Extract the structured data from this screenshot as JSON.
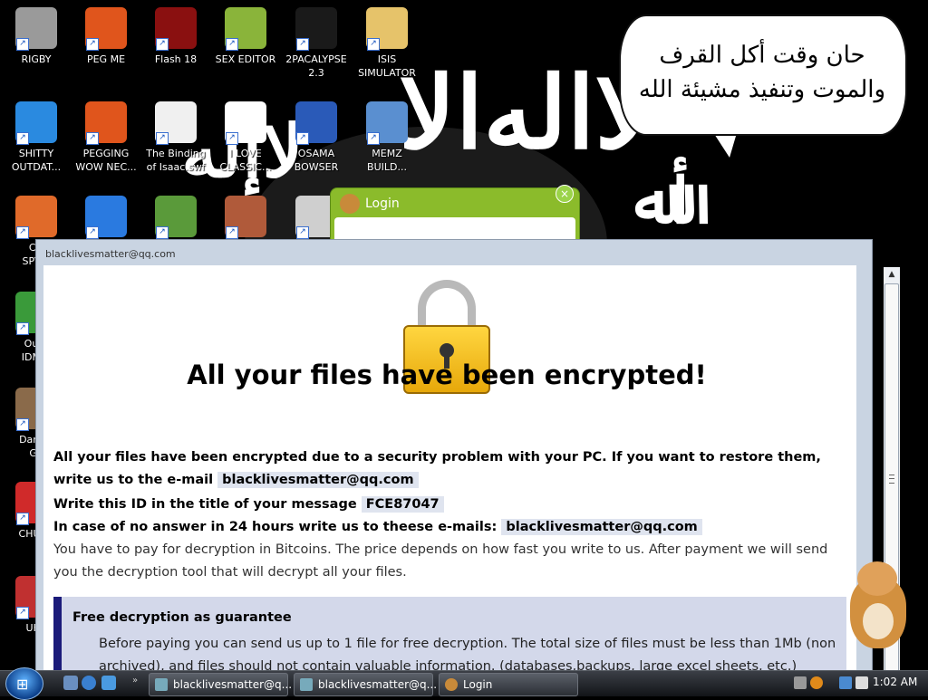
{
  "desktop": {
    "icons": [
      {
        "label": "RIGBY",
        "icon": "raccoon-icon",
        "color": "#9a9a9a"
      },
      {
        "label": "PEG ME",
        "icon": "peggle-icon",
        "color": "#e0551c"
      },
      {
        "label": "Flash 18",
        "icon": "flash-icon",
        "color": "#8a1010"
      },
      {
        "label": "SEX EDITOR",
        "icon": "hex-editor-icon",
        "color": "#8ab43a"
      },
      {
        "label": "2PACALYPSE\n2.3",
        "icon": "console-icon",
        "color": "#1a1a1a"
      },
      {
        "label": "ISIS\nSIMULATOR",
        "icon": "folder-icon",
        "color": "#e6c36a"
      },
      {
        "label": "SHITTY\nOUTDAT...",
        "icon": "chrome-icon",
        "color": "#2a8ae0"
      },
      {
        "label": "PEGGING\nWOW NEC...",
        "icon": "peggle-icon",
        "color": "#e0551c"
      },
      {
        "label": "The Binding\nof Isaac.swf",
        "icon": "flash-file-icon",
        "color": "#f0f0f0"
      },
      {
        "label": "I LOVE\nCLASSIC...",
        "icon": "calendar-icon",
        "color": "#ffffff"
      },
      {
        "label": "OSAMA\nBOWSER",
        "icon": "obama-logo-icon",
        "color": "#2a5ab8"
      },
      {
        "label": "MEMZ\nBUILD...",
        "icon": "window-icon",
        "color": "#5a8fd0"
      },
      {
        "label": "CO\nSPYW",
        "icon": "pinwheel-icon",
        "color": "#e06a2a"
      },
      {
        "label": "",
        "icon": "peggle-icon",
        "color": "#2a7ae0"
      },
      {
        "label": "",
        "icon": "csharp-icon",
        "color": "#5a9a3a"
      },
      {
        "label": "",
        "icon": "portrait-64-icon",
        "color": "#b05a3a"
      },
      {
        "label": "",
        "icon": "server-icon",
        "color": "#cfcfcf"
      },
      {
        "label": "Outo\nIDM C",
        "icon": "idm-icon",
        "color": "#3a9a3a"
      },
      {
        "label": "DarkOl\nGa",
        "icon": "squirrel-icon",
        "color": "#8a6a4a"
      },
      {
        "label": "CHUZZ",
        "icon": "chuzzle-icon",
        "color": "#d02a2a"
      },
      {
        "label": "UKR",
        "icon": "app-icon",
        "color": "#c03030"
      }
    ],
    "speech_bubble": {
      "line1": "حان وقت أكل القرف",
      "line2": "والموت وتنفيذ مشيئة الله"
    }
  },
  "login_window": {
    "title": "Login",
    "close": "×"
  },
  "ransom_window": {
    "title": "blacklivesmatter@qq.com",
    "headline": "All your files have been encrypted!",
    "p1_text": "All your files have been encrypted due to a security problem with your PC. If you want to restore them, write us to the e-mail",
    "email": "blacklivesmatter@qq.com",
    "p2_text": "Write this ID in the title of your message",
    "id": "FCE87047",
    "p3_text": "In case of no answer in 24 hours write us to theese e-mails:",
    "p4_text": "You have to pay for decryption in Bitcoins. The price depends on how fast you write to us. After payment we will send you the decryption tool that will decrypt all your files.",
    "guarantee_title": "Free decryption as guarantee",
    "guarantee_text": "Before paying you can send us up to 1 file for free decryption. The total size of files must be less than 1Mb (non archived), and files should not contain valuable information. (databases,backups, large excel sheets, etc.)"
  },
  "taskbar": {
    "tasks": [
      {
        "label": "blacklivesmatter@q...",
        "icon": "window-icon"
      },
      {
        "label": "blacklivesmatter@q...",
        "icon": "window-icon"
      },
      {
        "label": "Login",
        "icon": "hamster-icon"
      }
    ],
    "clock": "1:02 AM"
  }
}
